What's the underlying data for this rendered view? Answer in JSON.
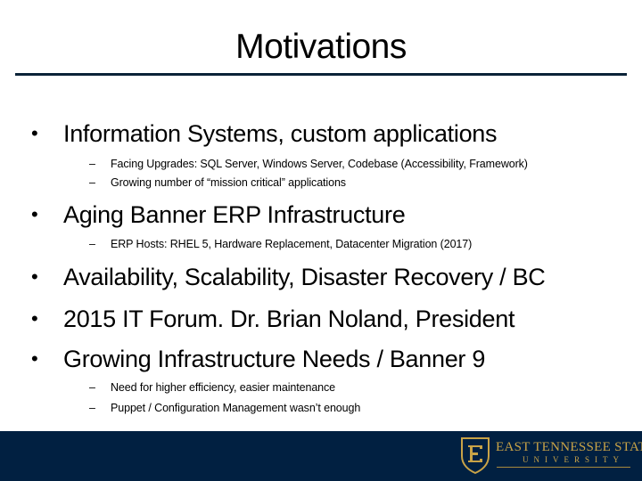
{
  "slide": {
    "title": "Motivations",
    "bullets": [
      {
        "text": "Information Systems, custom applications",
        "sub": [
          "Facing Upgrades: SQL Server, Windows Server, Codebase (Accessibility, Framework)",
          "Growing number of “mission critical” applications"
        ]
      },
      {
        "text": "Aging Banner ERP Infrastructure",
        "sub": [
          "ERP Hosts: RHEL 5, Hardware Replacement, Datacenter Migration (2017)"
        ]
      },
      {
        "text": "Availability, Scalability, Disaster Recovery / BC",
        "sub": []
      },
      {
        "text": "2015 IT Forum. Dr. Brian Noland, President",
        "sub": []
      },
      {
        "text": "Growing Infrastructure Needs / Banner 9",
        "sub": [
          "Need for higher efficiency, easier maintenance",
          "Puppet / Configuration Management wasn’t enough"
        ]
      }
    ],
    "bullet_glyph": "•",
    "dash_glyph": "–"
  },
  "footer": {
    "logo_icon": "etsu-shield-icon",
    "logo_letter": "E",
    "university_name": "EAST TENNESSEE STATE",
    "university_sub": "UNIVERSITY",
    "colors": {
      "band": "#012041",
      "gold": "#c9a347",
      "rule": "#0b2338"
    }
  }
}
